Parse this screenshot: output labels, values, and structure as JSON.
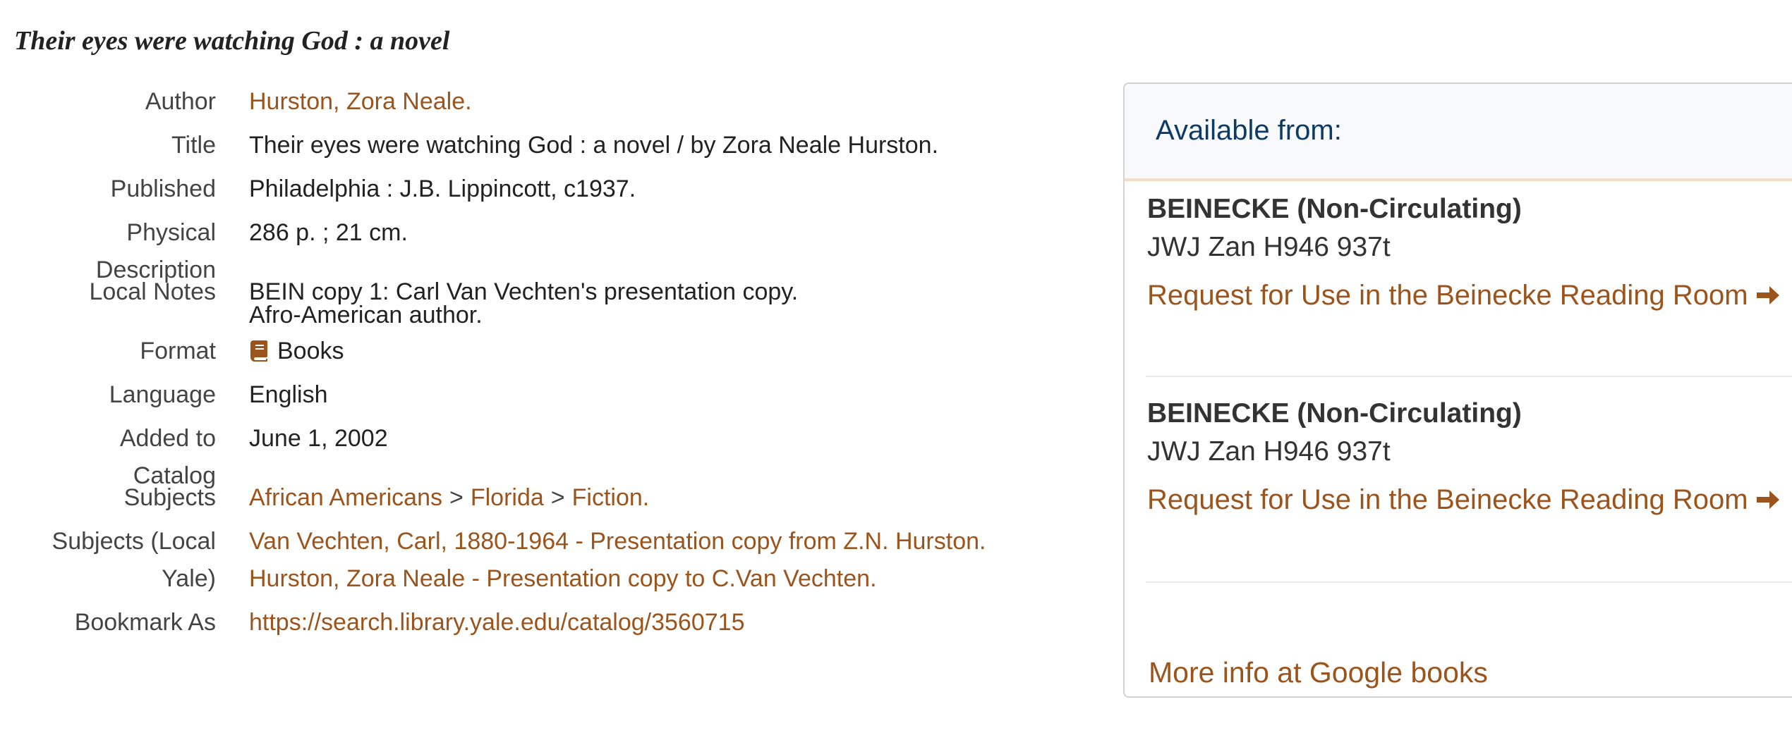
{
  "record": {
    "title": "Their eyes were watching God : a novel"
  },
  "fields": {
    "author": {
      "label": "Author",
      "value": "Hurston, Zora Neale."
    },
    "title": {
      "label": "Title",
      "value": "Their eyes were watching God : a novel / by Zora Neale Hurston."
    },
    "published": {
      "label": "Published",
      "value": "Philadelphia : J.B. Lippincott, c1937."
    },
    "physical": {
      "label_line1": "Physical",
      "label_line2": "Description",
      "value": "286 p. ; 21 cm."
    },
    "local_notes": {
      "label": "Local Notes",
      "lines": [
        "BEIN copy 1: Carl Van Vechten's presentation copy.",
        "Afro-American author."
      ]
    },
    "format": {
      "label": "Format",
      "value": "Books",
      "icon": "book-icon"
    },
    "language": {
      "label": "Language",
      "value": "English"
    },
    "added": {
      "label_line1": "Added to",
      "label_line2": "Catalog",
      "value": "June 1, 2002"
    },
    "subjects": {
      "label": "Subjects",
      "items": [
        "African Americans",
        "Florida",
        "Fiction."
      ],
      "separator": ">"
    },
    "subjects_local": {
      "label_line1": "Subjects (Local",
      "label_line2": "Yale)",
      "items": [
        "Van Vechten, Carl, 1880-1964 - Presentation copy from Z.N. Hurston.",
        "Hurston, Zora Neale - Presentation copy to C.Van Vechten."
      ]
    },
    "bookmark": {
      "label": "Bookmark As",
      "value": "https://search.library.yale.edu/catalog/3560715"
    }
  },
  "availability": {
    "header": "Available from:",
    "holdings": [
      {
        "location": "BEINECKE (Non-Circulating)",
        "call_number": "JWJ Zan H946 937t",
        "request_label": "Request for Use in the Beinecke Reading Room"
      },
      {
        "location": "BEINECKE (Non-Circulating)",
        "call_number": "JWJ Zan H946 937t",
        "request_label": "Request for Use in the Beinecke Reading Room"
      }
    ],
    "google_label": "More info at Google books"
  },
  "colors": {
    "link": "#9c541d",
    "header_text": "#0d3b66",
    "header_border": "#f3dcc3"
  }
}
